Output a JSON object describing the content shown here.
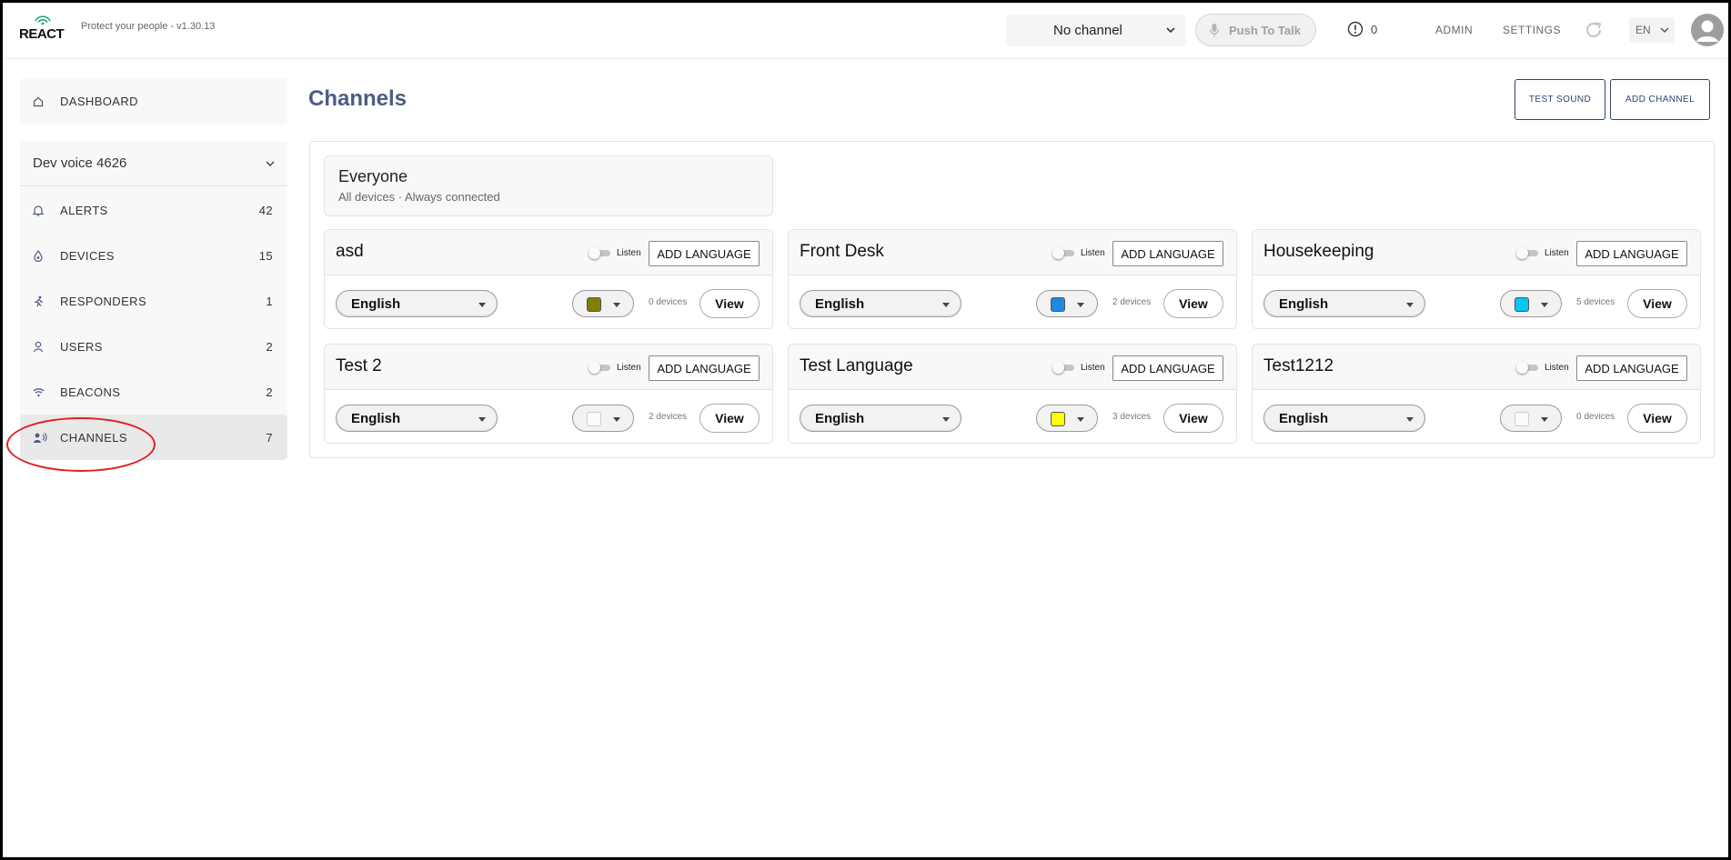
{
  "app": {
    "logo_text": "REACT",
    "tagline": "Protect your people - v1.30.13"
  },
  "header": {
    "channel_select": "No channel",
    "push_to_talk": "Push To Talk",
    "alert_count": "0",
    "admin": "ADMIN",
    "settings": "SETTINGS",
    "language": "EN"
  },
  "sidebar": {
    "dashboard": "DASHBOARD",
    "org_name": "Dev voice 4626",
    "items": [
      {
        "label": "ALERTS",
        "count": "42",
        "icon": "bell-icon"
      },
      {
        "label": "DEVICES",
        "count": "15",
        "icon": "device-icon"
      },
      {
        "label": "RESPONDERS",
        "count": "1",
        "icon": "runner-icon"
      },
      {
        "label": "USERS",
        "count": "2",
        "icon": "user-icon"
      },
      {
        "label": "BEACONS",
        "count": "2",
        "icon": "wifi-icon"
      },
      {
        "label": "CHANNELS",
        "count": "7",
        "icon": "channel-icon"
      }
    ]
  },
  "main": {
    "title": "Channels",
    "test_sound": "TEST SOUND",
    "add_channel": "ADD CHANNEL",
    "everyone": {
      "title": "Everyone",
      "subtitle": "All devices · Always connected"
    },
    "card_labels": {
      "listen": "Listen",
      "add_language": "ADD LANGUAGE",
      "view": "View"
    },
    "channels": [
      {
        "name": "asd",
        "language": "English",
        "color": "#808000",
        "devices": "0 devices"
      },
      {
        "name": "Front Desk",
        "language": "English",
        "color": "#1e88e5",
        "devices": "2 devices"
      },
      {
        "name": "Housekeeping",
        "language": "English",
        "color": "#03c6f2",
        "devices": "5 devices"
      },
      {
        "name": "Test 2",
        "language": "English",
        "color": "",
        "devices": "2 devices"
      },
      {
        "name": "Test Language",
        "language": "English",
        "color": "#ffff00",
        "devices": "3 devices"
      },
      {
        "name": "Test1212",
        "language": "English",
        "color": "",
        "devices": "0 devices"
      }
    ]
  }
}
